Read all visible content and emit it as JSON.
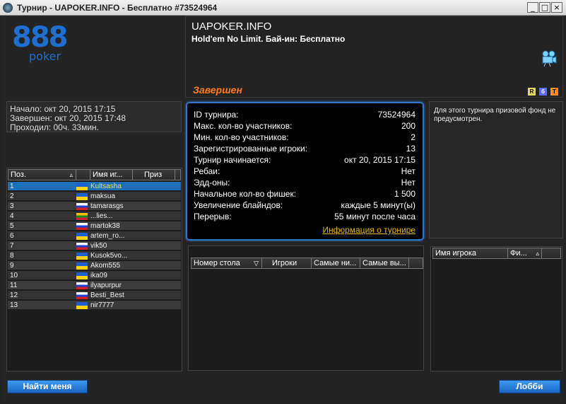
{
  "window": {
    "title": "Турнир - UAPOKER.INFO - Бесплатно #73524964",
    "min_label": "_",
    "max_label": "□",
    "close_label": "×"
  },
  "logo": {
    "number": "888",
    "word": "poker",
    "color": "#1e6fd0"
  },
  "header": {
    "site": "UAPOKER.INFO",
    "game": "Hold'em No Limit. Бай-ин: Бесплатно",
    "status": "Завершен",
    "status_color": "#ff7a1a",
    "icons": [
      "camera-icon"
    ],
    "mini_icons": [
      {
        "name": "rebuy-icon",
        "label": "R",
        "color": "#e8d84a"
      },
      {
        "name": "addon-icon",
        "label": "б",
        "color": "#5a6cff"
      },
      {
        "name": "turbo-icon",
        "label": "T",
        "color": "#ff8a1e"
      }
    ]
  },
  "times": {
    "start": "Начало: окт 20, 2015 17:15",
    "end": "Завершен: окт 20, 2015 17:48",
    "duration": "Проходил: 00ч. 33мин."
  },
  "info": {
    "rows": [
      {
        "k": "ID турнира:",
        "v": "73524964"
      },
      {
        "k": "Макс. кол-во участников:",
        "v": "200"
      },
      {
        "k": "Мин. кол-во участников:",
        "v": "2"
      },
      {
        "k": "Зарегистрированные игроки:",
        "v": "13"
      },
      {
        "k": "Турнир начинается:",
        "v": "окт 20, 2015 17:15"
      },
      {
        "k": "Ребаи:",
        "v": "Нет"
      },
      {
        "k": "Эдд-оны:",
        "v": "Нет"
      },
      {
        "k": "Начальное кол-во фишек:",
        "v": "1 500"
      },
      {
        "k": "Увеличение блайндов:",
        "v": "каждые 5 минут(ы)"
      },
      {
        "k": "Перерыв:",
        "v": "55 минут после часа"
      }
    ],
    "link": "Информация о турнире",
    "accent": "#2f74c9"
  },
  "prize": {
    "text": "Для этого турнира призовой фонд не предусмотрен."
  },
  "players_grid": {
    "headers": [
      "Поз.",
      "Имя иг...",
      "Приз"
    ],
    "sort_icon": "sort-icon",
    "rows": [
      {
        "pos": "1",
        "name": "Kultsasha",
        "flag": "ua"
      },
      {
        "pos": "2",
        "name": "maksua",
        "flag": "ua"
      },
      {
        "pos": "3",
        "name": "tamarasgs",
        "flag": "ru"
      },
      {
        "pos": "4",
        "name": "...lies...",
        "flag": "lt"
      },
      {
        "pos": "5",
        "name": "martok38",
        "flag": "ru"
      },
      {
        "pos": "6",
        "name": "artem_ro...",
        "flag": "ua"
      },
      {
        "pos": "7",
        "name": "vik50",
        "flag": "ru"
      },
      {
        "pos": "8",
        "name": "Kusok5vo...",
        "flag": "ua"
      },
      {
        "pos": "9",
        "name": "Akom555",
        "flag": "ua"
      },
      {
        "pos": "10",
        "name": "ika09",
        "flag": "ua"
      },
      {
        "pos": "11",
        "name": "ilyapurpur",
        "flag": "ru"
      },
      {
        "pos": "12",
        "name": "Besti_Best",
        "flag": "ru"
      },
      {
        "pos": "13",
        "name": "nir7777",
        "flag": "ua"
      }
    ],
    "selected_color": "#1e6fb8",
    "selected_text_color": "#f0e050"
  },
  "tables_grid": {
    "headers": [
      "Номер стола",
      "Игроки",
      "Самые ни...",
      "Самые вы..."
    ]
  },
  "table_players_grid": {
    "headers": [
      "Имя игрока",
      "Фи..."
    ]
  },
  "buttons": {
    "find_me": "Найти меня",
    "lobby": "Лобби"
  }
}
